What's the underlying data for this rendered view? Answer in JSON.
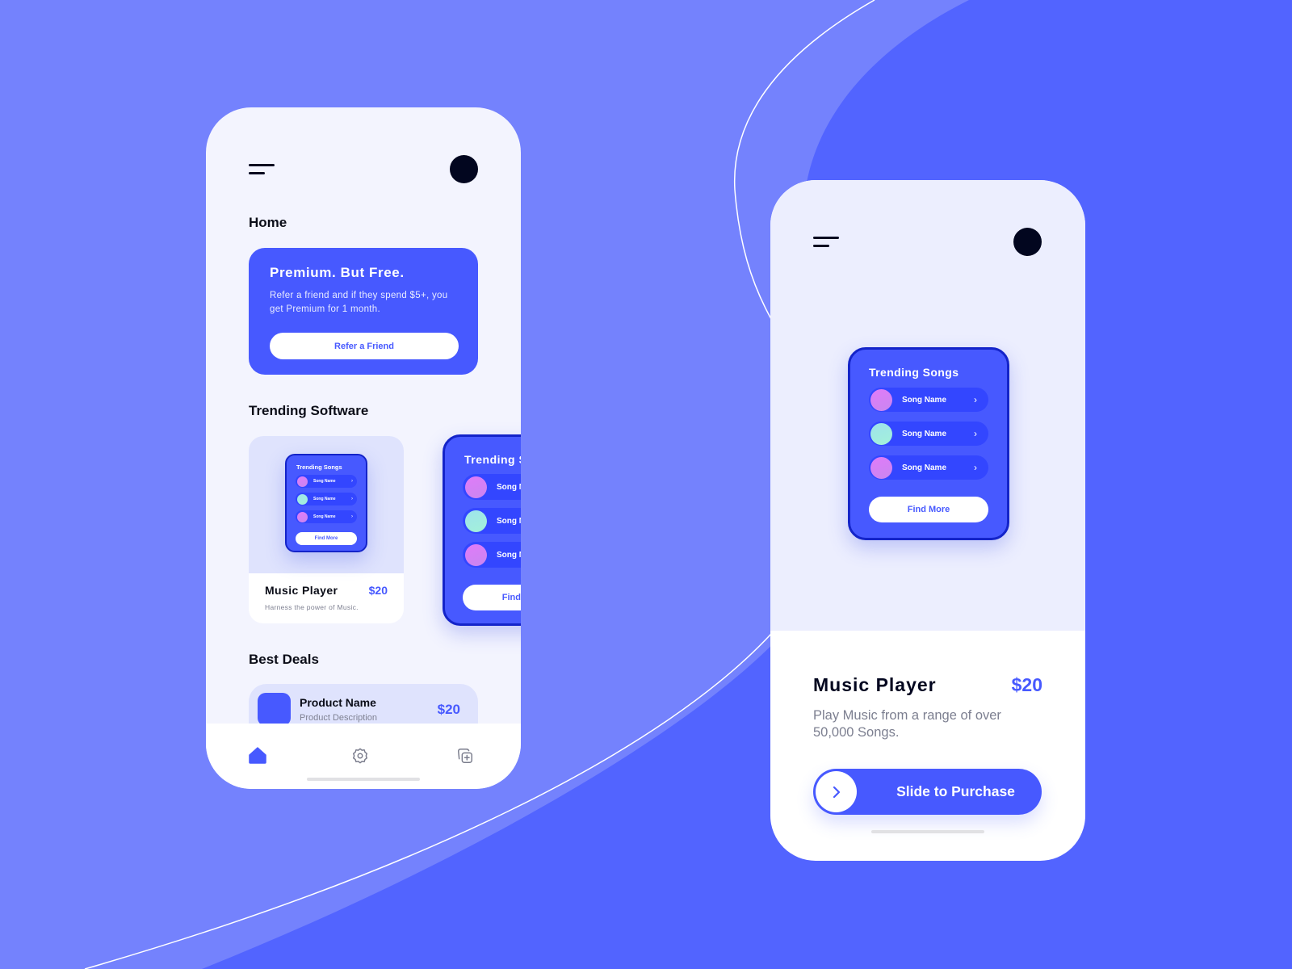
{
  "colors": {
    "accent": "#4759ff",
    "bg_light": "#7482fd",
    "bg_dark": "#5264ff",
    "dark": "#02061f"
  },
  "left_phone": {
    "home_title": "Home",
    "promo": {
      "title": "Premium. But Free.",
      "description": "Refer a friend and if they spend $5+, you get Premium for 1 month.",
      "button": "Refer a Friend"
    },
    "trending_title": "Trending Software",
    "software_card": {
      "name": "Music Player",
      "price": "$20",
      "description": "Harness the power of Music.",
      "preview": {
        "title": "Trending Songs",
        "songs": [
          "Song Name",
          "Song Name",
          "Song Name"
        ],
        "button": "Find More"
      }
    },
    "second_card": {
      "title": "Trending Songs",
      "songs": [
        "Song Name",
        "Song Name",
        "Song Name"
      ],
      "button": "Find More"
    },
    "best_deals_title": "Best Deals",
    "deal": {
      "name": "Product Name",
      "description": "Product Description",
      "price": "$20"
    },
    "nav": [
      {
        "icon": "home-icon",
        "active": true
      },
      {
        "icon": "gear-icon",
        "active": false
      },
      {
        "icon": "add-copy-icon",
        "active": false
      }
    ]
  },
  "right_phone": {
    "preview": {
      "title": "Trending Songs",
      "songs": [
        "Song Name",
        "Song Name",
        "Song Name"
      ],
      "button": "Find More"
    },
    "product_name": "Music Player",
    "price": "$20",
    "description": "Play Music from a range of over 50,000 Songs.",
    "slide_label": "Slide to Purchase"
  }
}
